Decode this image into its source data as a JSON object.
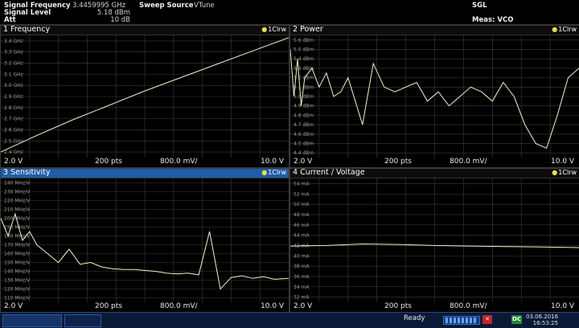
{
  "header": {
    "signal_frequency_label": "Signal Frequency",
    "signal_frequency_value": "3.4459995 GHz",
    "signal_level_label": "Signal Level",
    "signal_level_value": "5.18 dBm",
    "att_label": "Att",
    "att_value": "10 dB",
    "sweep_source_label": "Sweep Source",
    "sweep_source_value": "VTune",
    "sgl": "SGL",
    "meas": "Meas: VCO Characterization"
  },
  "windows": [
    {
      "title": "1 Frequency",
      "trace": "1Clrw",
      "x_start": "2.0 V",
      "points": "200 pts",
      "step": "800.0 mV/",
      "x_end": "10.0 V",
      "y_labels": [
        "3.4 GHz",
        "3.3 GHz",
        "3.2 GHz",
        "3.1 GHz",
        "3.0 GHz",
        "2.9 GHz",
        "2.8 GHz",
        "2.7 GHz",
        "2.6 GHz",
        "2.5 GHz",
        "2.4 GHz"
      ]
    },
    {
      "title": "2 Power",
      "trace": "1Clrw",
      "x_start": "2.0 V",
      "points": "200 pts",
      "step": "800.0 mV/",
      "x_end": "10.0 V",
      "y_labels": [
        "5.6 dBm",
        "5.5 dBm",
        "5.4 dBm",
        "5.3 dBm",
        "5.2 dBm",
        "5.1 dBm",
        "5.0 dBm",
        "4.9 dBm",
        "4.8 dBm",
        "4.7 dBm",
        "4.6 dBm",
        "4.5 dBm",
        "4.4 dBm"
      ]
    },
    {
      "title": "3 Sensitivity",
      "trace": "1Clrw",
      "x_start": "2.0 V",
      "points": "200 pts",
      "step": "800.0 mV/",
      "x_end": "10.0 V",
      "y_labels": [
        "240 MHz/V",
        "230 MHz/V",
        "220 MHz/V",
        "210 MHz/V",
        "200 MHz/V",
        "190 MHz/V",
        "180 MHz/V",
        "170 MHz/V",
        "160 MHz/V",
        "150 MHz/V",
        "140 MHz/V",
        "130 MHz/V",
        "120 MHz/V",
        "110 MHz/V"
      ]
    },
    {
      "title": "4 Current / Voltage",
      "trace": "1Clrw",
      "x_start": "2.0 V",
      "points": "200 pts",
      "step": "800.0 mV/",
      "x_end": "10.0 V",
      "y_labels": [
        "54 mA",
        "52 mA",
        "50 mA",
        "48 mA",
        "46 mA",
        "44 mA",
        "42 mA",
        "40 mA",
        "38 mA",
        "36 mA",
        "34 mA",
        "32 mA"
      ]
    }
  ],
  "status": {
    "ready": "Ready",
    "date": "03.06.2016",
    "time": "16:53:25",
    "dc_label": "DC"
  },
  "colors": {
    "trace": "#f2f2c8",
    "active_titlebar": "#1f5da8",
    "grid": "#3c3c3c",
    "status_bg": "#0a1a36"
  },
  "chart_data": [
    {
      "type": "line",
      "title": "1 Frequency",
      "xlabel": "",
      "ylabel": "",
      "xlim": [
        2.0,
        10.0
      ],
      "ylim": [
        2.35,
        3.45
      ],
      "grid": true,
      "series": [
        {
          "x": [
            2.0,
            3.0,
            4.0,
            5.0,
            6.0,
            7.0,
            8.0,
            9.0,
            10.0
          ],
          "y": [
            2.4,
            2.55,
            2.69,
            2.82,
            2.95,
            3.07,
            3.19,
            3.31,
            3.43
          ]
        }
      ]
    },
    {
      "type": "line",
      "title": "2 Power",
      "xlabel": "",
      "ylabel": "",
      "xlim": [
        2.0,
        10.0
      ],
      "ylim": [
        4.35,
        5.65
      ],
      "grid": true,
      "series": [
        {
          "x": [
            2.0,
            2.1,
            2.2,
            2.3,
            2.4,
            2.6,
            2.8,
            3.0,
            3.2,
            3.4,
            3.6,
            3.8,
            4.0,
            4.3,
            4.6,
            4.9,
            5.2,
            5.5,
            5.8,
            6.1,
            6.4,
            6.7,
            7.0,
            7.3,
            7.6,
            7.9,
            8.2,
            8.5,
            8.8,
            9.1,
            9.4,
            9.7,
            10.0
          ],
          "y": [
            5.5,
            5.0,
            5.4,
            4.9,
            5.2,
            5.3,
            5.1,
            5.25,
            5.0,
            5.05,
            5.2,
            4.95,
            4.7,
            5.35,
            5.1,
            5.05,
            5.1,
            5.15,
            4.95,
            5.05,
            4.9,
            5.0,
            5.1,
            5.05,
            4.95,
            5.15,
            5.0,
            4.7,
            4.5,
            4.45,
            4.8,
            5.2,
            5.3
          ]
        }
      ]
    },
    {
      "type": "line",
      "title": "3 Sensitivity",
      "xlabel": "",
      "ylabel": "",
      "xlim": [
        2.0,
        10.0
      ],
      "ylim": [
        105,
        245
      ],
      "grid": true,
      "series": [
        {
          "x": [
            2.0,
            2.2,
            2.4,
            2.6,
            2.8,
            3.0,
            3.3,
            3.6,
            3.9,
            4.2,
            4.5,
            4.8,
            5.1,
            5.4,
            5.7,
            6.0,
            6.3,
            6.6,
            6.9,
            7.2,
            7.5,
            7.8,
            8.1,
            8.4,
            8.7,
            9.0,
            9.3,
            9.6,
            10.0
          ],
          "y": [
            200,
            180,
            205,
            175,
            185,
            170,
            160,
            150,
            165,
            148,
            150,
            145,
            143,
            142,
            142,
            141,
            140,
            138,
            137,
            138,
            136,
            185,
            120,
            133,
            135,
            132,
            134,
            131,
            132
          ]
        }
      ]
    },
    {
      "type": "line",
      "title": "4 Current / Voltage",
      "xlabel": "",
      "ylabel": "",
      "xlim": [
        2.0,
        10.0
      ],
      "ylim": [
        31,
        55
      ],
      "grid": true,
      "series": [
        {
          "x": [
            2.0,
            3.0,
            4.0,
            5.0,
            6.0,
            7.0,
            8.0,
            9.0,
            10.0
          ],
          "y": [
            41.9,
            42.0,
            42.3,
            42.2,
            42.0,
            41.9,
            41.8,
            41.7,
            41.6
          ]
        }
      ]
    }
  ]
}
